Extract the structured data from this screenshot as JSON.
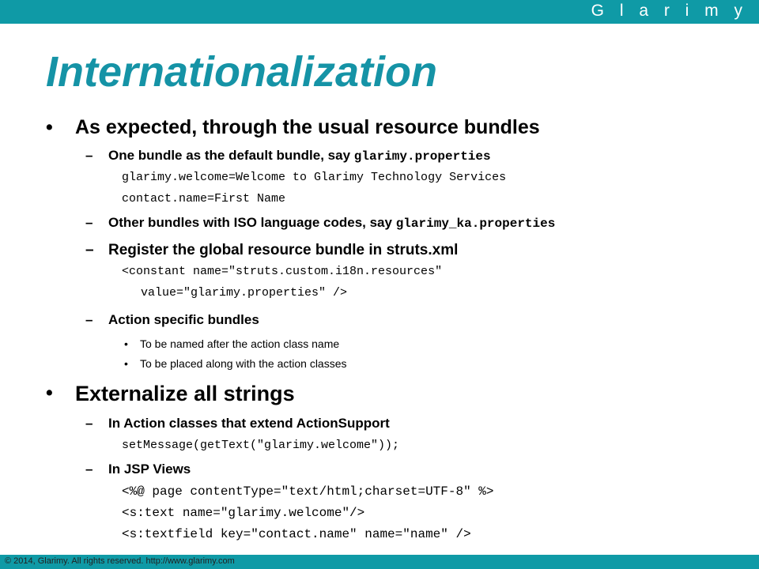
{
  "header": {
    "brand": "G l a r i m y"
  },
  "slide": {
    "title": "Internationalization",
    "bullet1": {
      "text": "As expected, through the usual resource bundles",
      "sub1": {
        "prefix": "One bundle as the default bundle, say ",
        "code": "glarimy.properties",
        "lines": [
          "glarimy.welcome=Welcome to Glarimy Technology Services",
          "contact.name=First Name"
        ]
      },
      "sub2": {
        "prefix": "Other bundles with ISO language codes, say ",
        "code": "glarimy_ka.properties"
      },
      "sub3": {
        "text": "Register the global resource bundle in struts.xml",
        "lines": [
          "<constant name=\"struts.custom.i18n.resources\"",
          "value=\"glarimy.properties\" />"
        ]
      },
      "sub4": {
        "text": "Action specific bundles",
        "items": [
          "To be named after the action class name",
          "To be placed along with the action classes"
        ]
      }
    },
    "bullet2": {
      "text": "Externalize all strings",
      "sub1": {
        "text": "In Action classes that extend ActionSupport",
        "lines": [
          "setMessage(getText(\"glarimy.welcome\"));"
        ]
      },
      "sub2": {
        "text": "In JSP Views",
        "lines": [
          "<%@ page contentType=\"text/html;charset=UTF-8\" %>",
          "<s:text name=\"glarimy.welcome\"/>",
          "<s:textfield key=\"contact.name\" name=\"name\" />"
        ]
      }
    }
  },
  "footer": {
    "text": "© 2014, Glarimy. All rights reserved. http://www.glarimy.com"
  },
  "colors": {
    "accent": "#0f9aa6",
    "title": "#1593a6"
  }
}
